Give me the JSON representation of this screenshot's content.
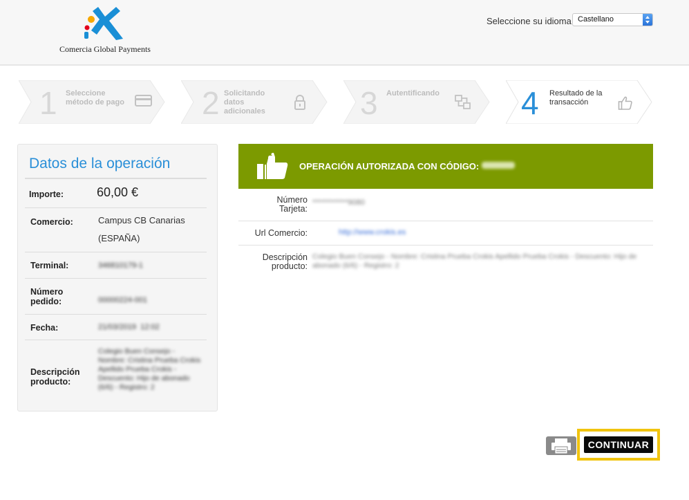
{
  "header": {
    "logo_text": "Comercia Global Payments",
    "language_label": "Seleccione su idioma",
    "language_selected": "Castellano"
  },
  "steps": [
    {
      "number": "1",
      "label": "Seleccione método de pago",
      "icon": "credit-card-icon"
    },
    {
      "number": "2",
      "label": "Solicitando datos adicionales",
      "icon": "lock-icon"
    },
    {
      "number": "3",
      "label": "Autentificando",
      "icon": "network-icon"
    },
    {
      "number": "4",
      "label": "Resultado de la transacción",
      "icon": "thumbs-up-icon",
      "active": true
    }
  ],
  "operation": {
    "title": "Datos de la operación",
    "rows": [
      {
        "label": "Importe:",
        "value": "60,00 €"
      },
      {
        "label": "Comercio:",
        "value_line1": "Campus CB Canarias",
        "value_line2": "(ESPAÑA)"
      },
      {
        "label": "Terminal:",
        "value": "346810179-1"
      },
      {
        "label_line1": "Número",
        "label_line2": "pedido:",
        "value": "00000224-001"
      },
      {
        "label": "Fecha:",
        "value": "21/03/2019  12:02"
      },
      {
        "label_line1": "Descripción",
        "label_line2": "producto:",
        "value": "Colegio Buen Consejo - Nombre: Cristina Prueba Crokis Apellido Prueba Crokis - Descuento: Hijo de abonado (6/6) - Registro: 2"
      }
    ]
  },
  "result": {
    "banner_text": "OPERACIÓN AUTORIZADA CON CÓDIGO:",
    "banner_code": "002179",
    "rows": [
      {
        "label_line1": "Número",
        "label_line2": "Tarjeta:",
        "value": "************9080"
      },
      {
        "label": "Url Comercio:",
        "value": "http://www.crokis.es"
      },
      {
        "label_line1": "Descripción",
        "label_line2": "producto:",
        "value": "Colegio Buen Consejo - Nombre: Cristina Prueba Crokis Apellido Prueba Crokis - Descuento: Hijo de abonado (6/6) - Registro: 2"
      }
    ]
  },
  "footer": {
    "continue_label": "CONTINUAR"
  },
  "colors": {
    "accent_blue": "#2a8fd8",
    "success_green": "#7c9a00",
    "highlight_yellow": "#f1c40f"
  }
}
